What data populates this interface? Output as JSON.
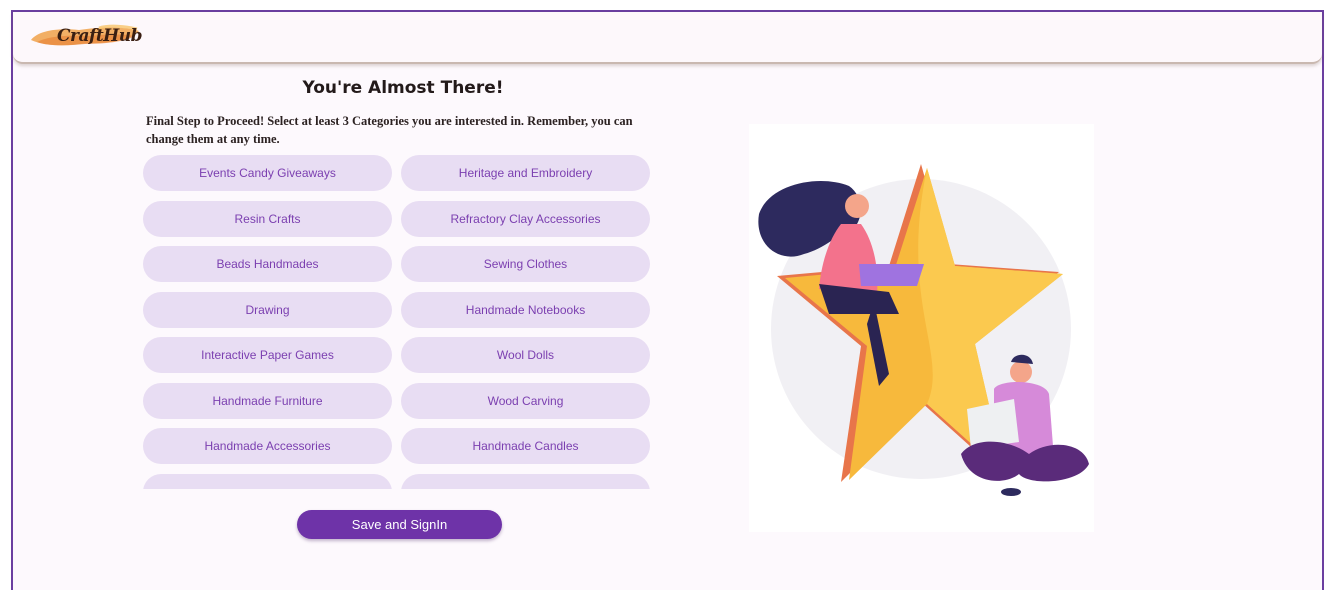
{
  "header": {
    "logo_text": "CraftHub",
    "brand_color": "#6e33a8"
  },
  "main": {
    "title": "You're Almost There!",
    "subtitle": "Final Step to Proceed! Select at least 3 Categories you are interested in. Remember, you can change them at any time.",
    "categories": [
      "Events Candy Giveaways",
      "Heritage and Embroidery",
      "Resin Crafts",
      "Refractory Clay Accessories",
      "Beads Handmades",
      "Sewing Clothes",
      "Drawing",
      "Handmade Notebooks",
      "Interactive Paper Games",
      "Wool Dolls",
      "Handmade Furniture",
      "Wood Carving",
      "Handmade Accessories",
      "Handmade Candles",
      "",
      ""
    ],
    "save_label": "Save and SignIn"
  },
  "colors": {
    "pill_bg": "#e8ddf3",
    "pill_text": "#7b3fb0",
    "frame_border": "#6b3fa0"
  }
}
